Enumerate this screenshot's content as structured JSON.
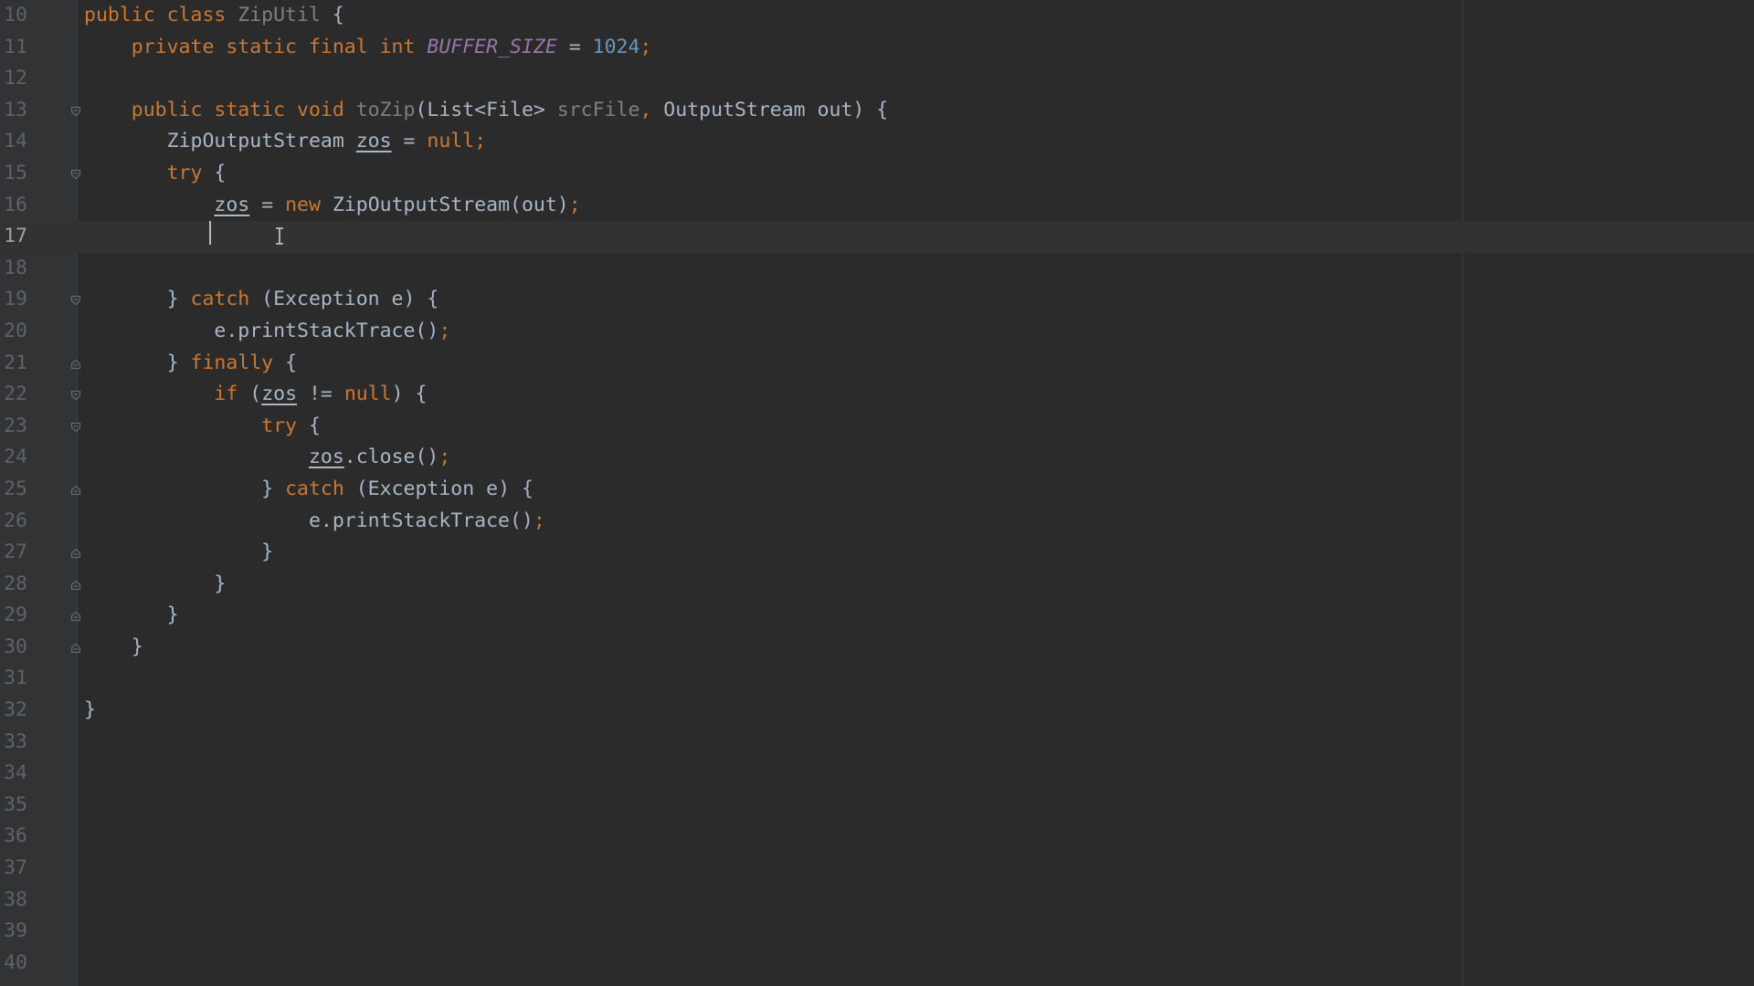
{
  "editor": {
    "current_line": 17,
    "colors": {
      "background": "#2b2b2b",
      "gutter": "#313335",
      "keyword": "#cc7832",
      "text": "#a9b7c6",
      "parameter": "#808080",
      "number": "#6897bb",
      "constant": "#9876aa"
    },
    "lines": [
      {
        "num": "10",
        "fold": "",
        "tokens": [
          {
            "t": "public class ",
            "c": "kw"
          },
          {
            "t": "ZipUtil ",
            "c": "pa"
          },
          {
            "t": "{",
            "c": "pl"
          }
        ]
      },
      {
        "num": "11",
        "fold": "",
        "tokens": [
          {
            "t": "    private static final int ",
            "c": "kw"
          },
          {
            "t": "BUFFER_SIZE",
            "c": "cst"
          },
          {
            "t": " = ",
            "c": "pl"
          },
          {
            "t": "1024",
            "c": "num"
          },
          {
            "t": ";",
            "c": "kw"
          }
        ]
      },
      {
        "num": "12",
        "fold": "",
        "tokens": []
      },
      {
        "num": "13",
        "fold": "open",
        "tokens": [
          {
            "t": "    public static void ",
            "c": "kw"
          },
          {
            "t": "toZip",
            "c": "pa"
          },
          {
            "t": "(List<File> ",
            "c": "pl"
          },
          {
            "t": "srcFile",
            "c": "pa"
          },
          {
            "t": ", ",
            "c": "kw"
          },
          {
            "t": "OutputStream out) {",
            "c": "pl"
          }
        ]
      },
      {
        "num": "14",
        "fold": "",
        "tokens": [
          {
            "t": "       ZipOutputStream ",
            "c": "pl"
          },
          {
            "t": "zos",
            "c": "pl mut"
          },
          {
            "t": " = ",
            "c": "pl"
          },
          {
            "t": "null",
            "c": "kw"
          },
          {
            "t": ";",
            "c": "kw"
          }
        ]
      },
      {
        "num": "15",
        "fold": "open",
        "tokens": [
          {
            "t": "       ",
            "c": "pl"
          },
          {
            "t": "try ",
            "c": "kw"
          },
          {
            "t": "{",
            "c": "pl"
          }
        ]
      },
      {
        "num": "16",
        "fold": "",
        "tokens": [
          {
            "t": "           ",
            "c": "pl"
          },
          {
            "t": "zos",
            "c": "pl mut"
          },
          {
            "t": " = ",
            "c": "pl"
          },
          {
            "t": "new ",
            "c": "kw"
          },
          {
            "t": "ZipOutputStream(out)",
            "c": "pl"
          },
          {
            "t": ";",
            "c": "kw"
          }
        ]
      },
      {
        "num": "17",
        "fold": "",
        "tokens": []
      },
      {
        "num": "18",
        "fold": "",
        "tokens": []
      },
      {
        "num": "19",
        "fold": "open",
        "tokens": [
          {
            "t": "       } ",
            "c": "pl"
          },
          {
            "t": "catch ",
            "c": "kw"
          },
          {
            "t": "(Exception e) {",
            "c": "pl"
          }
        ]
      },
      {
        "num": "20",
        "fold": "",
        "tokens": [
          {
            "t": "           e.printStackTrace()",
            "c": "pl"
          },
          {
            "t": ";",
            "c": "kw"
          }
        ]
      },
      {
        "num": "21",
        "fold": "close",
        "tokens": [
          {
            "t": "       } ",
            "c": "pl"
          },
          {
            "t": "finally ",
            "c": "kw"
          },
          {
            "t": "{",
            "c": "pl"
          }
        ]
      },
      {
        "num": "22",
        "fold": "open",
        "tokens": [
          {
            "t": "           ",
            "c": "pl"
          },
          {
            "t": "if ",
            "c": "kw"
          },
          {
            "t": "(",
            "c": "pl"
          },
          {
            "t": "zos",
            "c": "pl mut"
          },
          {
            "t": " != ",
            "c": "pl"
          },
          {
            "t": "null",
            "c": "kw"
          },
          {
            "t": ") {",
            "c": "pl"
          }
        ]
      },
      {
        "num": "23",
        "fold": "open",
        "tokens": [
          {
            "t": "               ",
            "c": "pl"
          },
          {
            "t": "try ",
            "c": "kw"
          },
          {
            "t": "{",
            "c": "pl"
          }
        ]
      },
      {
        "num": "24",
        "fold": "",
        "tokens": [
          {
            "t": "                   ",
            "c": "pl"
          },
          {
            "t": "zos",
            "c": "pl mut"
          },
          {
            "t": ".close()",
            "c": "pl"
          },
          {
            "t": ";",
            "c": "kw"
          }
        ]
      },
      {
        "num": "25",
        "fold": "close",
        "tokens": [
          {
            "t": "               } ",
            "c": "pl"
          },
          {
            "t": "catch ",
            "c": "kw"
          },
          {
            "t": "(Exception e) {",
            "c": "pl"
          }
        ]
      },
      {
        "num": "26",
        "fold": "",
        "tokens": [
          {
            "t": "                   e.printStackTrace()",
            "c": "pl"
          },
          {
            "t": ";",
            "c": "kw"
          }
        ]
      },
      {
        "num": "27",
        "fold": "close",
        "tokens": [
          {
            "t": "               }",
            "c": "pl"
          }
        ]
      },
      {
        "num": "28",
        "fold": "close",
        "tokens": [
          {
            "t": "           }",
            "c": "pl"
          }
        ]
      },
      {
        "num": "29",
        "fold": "close",
        "tokens": [
          {
            "t": "       }",
            "c": "pl"
          }
        ]
      },
      {
        "num": "30",
        "fold": "close",
        "tokens": [
          {
            "t": "    }",
            "c": "pl"
          }
        ]
      },
      {
        "num": "31",
        "fold": "",
        "tokens": []
      },
      {
        "num": "32",
        "fold": "",
        "tokens": [
          {
            "t": "}",
            "c": "pl"
          }
        ]
      },
      {
        "num": "33",
        "fold": "",
        "tokens": []
      },
      {
        "num": "34",
        "fold": "",
        "tokens": []
      },
      {
        "num": "35",
        "fold": "",
        "tokens": []
      },
      {
        "num": "36",
        "fold": "",
        "tokens": []
      },
      {
        "num": "37",
        "fold": "",
        "tokens": []
      },
      {
        "num": "38",
        "fold": "",
        "tokens": []
      },
      {
        "num": "39",
        "fold": "",
        "tokens": []
      },
      {
        "num": "40",
        "fold": "",
        "tokens": []
      }
    ]
  }
}
